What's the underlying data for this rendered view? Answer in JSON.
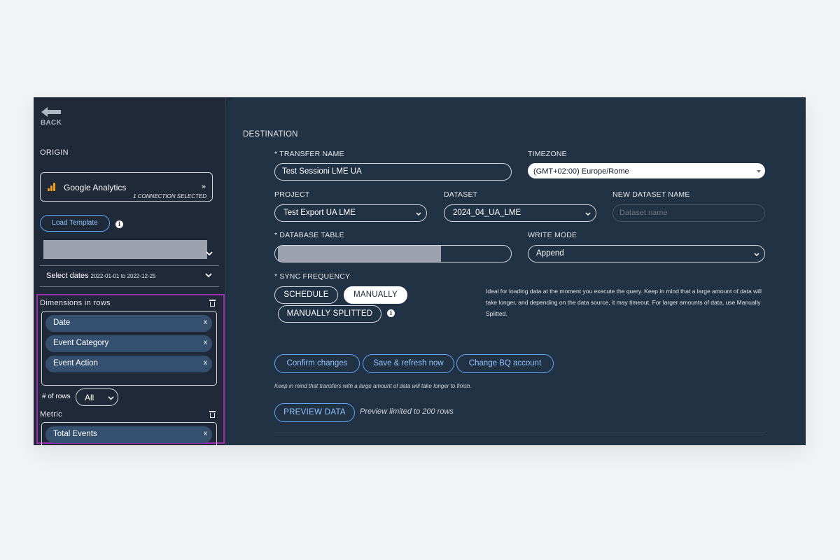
{
  "sidebar": {
    "back_label": "BACK",
    "origin_title": "ORIGIN",
    "source": {
      "name": "Google Analytics",
      "connections": "1 CONNECTION SELECTED",
      "chevron": "»"
    },
    "load_template_label": "Load Template",
    "dates": {
      "label": "Select dates",
      "range": "2022-01-01 to 2022-12-25"
    },
    "dimensions": {
      "title": "Dimensions in rows",
      "items": [
        {
          "label": "Date",
          "remove": "x"
        },
        {
          "label": "Event Category",
          "remove": "x"
        },
        {
          "label": "Event Action",
          "remove": "x"
        }
      ]
    },
    "rows": {
      "label": "# of rows",
      "value": "All"
    },
    "metric": {
      "title": "Metric",
      "items": [
        {
          "label": "Total Events",
          "remove": "x"
        }
      ]
    }
  },
  "destination": {
    "title": "DESTINATION",
    "transfer_name": {
      "label": "* TRANSFER NAME",
      "value": "Test Sessioni LME UA"
    },
    "timezone": {
      "label": "TIMEZONE",
      "value": "(GMT+02:00) Europe/Rome"
    },
    "project": {
      "label": "PROJECT",
      "value": "Test Export UA LME"
    },
    "dataset": {
      "label": "DATASET",
      "value": "2024_04_UA_LME"
    },
    "new_dataset": {
      "label": "NEW DATASET NAME",
      "placeholder": "Dataset name"
    },
    "database_table": {
      "label": "* DATABASE TABLE"
    },
    "write_mode": {
      "label": "WRITE MODE",
      "value": "Append"
    },
    "sync_frequency": {
      "label": "*  SYNC FREQUENCY",
      "options": [
        "SCHEDULE",
        "MANUALLY",
        "MANUALLY SPLITTED"
      ],
      "selected": "MANUALLY",
      "help": "Ideal for loading data at the moment you execute the query. Keep in mind that a large amount of data will take longer, and depending on the data source, it may timeout. For larger amounts of data, use Manually Splitted."
    },
    "actions": {
      "confirm": "Confirm changes",
      "save_refresh": "Save & refresh now",
      "change_bq": "Change BQ account"
    },
    "note": "Keep in mind that transfers with a large amount of data will take longer to finish.",
    "preview": {
      "button": "PREVIEW DATA",
      "note": "Preview limited to 200 rows"
    }
  },
  "colors": {
    "sidebar_bg": "#1f2937",
    "main_bg": "#223245",
    "accent_blue": "#60a5fa",
    "highlight": "#9b2fb0",
    "pill_bg": "#34506e",
    "ga_orange": "#f59e0b"
  }
}
